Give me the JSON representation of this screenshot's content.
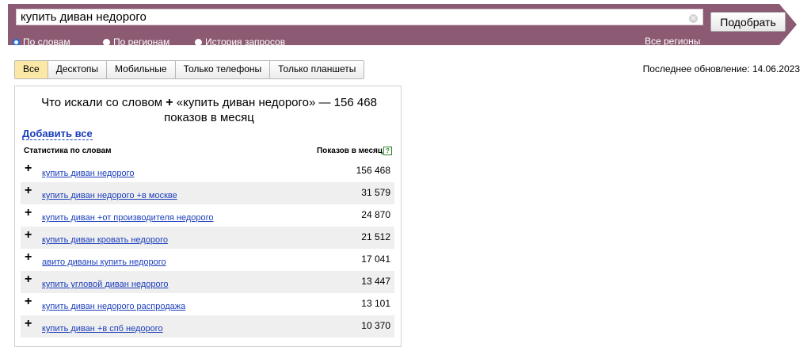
{
  "search": {
    "query": "купить диван недорого",
    "submit_label": "Подобрать",
    "regions_link": "Все регионы",
    "modes": [
      {
        "label": "По словам",
        "selected": true
      },
      {
        "label": "По регионам",
        "selected": false
      },
      {
        "label": "История запросов",
        "selected": false
      }
    ]
  },
  "tabs": [
    "Все",
    "Десктопы",
    "Мобильные",
    "Только телефоны",
    "Только планшеты"
  ],
  "active_tab": "Все",
  "last_update": "Последнее обновление: 14.06.2023",
  "results": {
    "title_prefix": "Что искали со словом",
    "title_rest": "«купить диван недорого» — 156 468 показов в месяц",
    "add_all": "Добавить все",
    "col_words": "Статистика по словам",
    "col_impressions": "Показов в месяц",
    "help_glyph": "?",
    "rows": [
      {
        "phrase": "купить диван недорого",
        "count": "156 468"
      },
      {
        "phrase": "купить диван недорого +в москве",
        "count": "31 579"
      },
      {
        "phrase": "купить диван +от производителя недорого",
        "count": "24 870"
      },
      {
        "phrase": "купить диван кровать недорого",
        "count": "21 512"
      },
      {
        "phrase": "авито диваны купить недорого",
        "count": "17 041"
      },
      {
        "phrase": "купить угловой диван недорого",
        "count": "13 447"
      },
      {
        "phrase": "купить диван недорого распродажа",
        "count": "13 101"
      },
      {
        "phrase": "купить диван +в спб недорого",
        "count": "10 370"
      }
    ]
  },
  "colors": {
    "bar": "#8c5a72",
    "link": "#1a3dbb",
    "active_tab": "#fbe8a6",
    "row_alt": "#efefef"
  },
  "icons": {
    "clear": "clear-icon",
    "plus": "plus-icon",
    "help": "help-icon"
  }
}
